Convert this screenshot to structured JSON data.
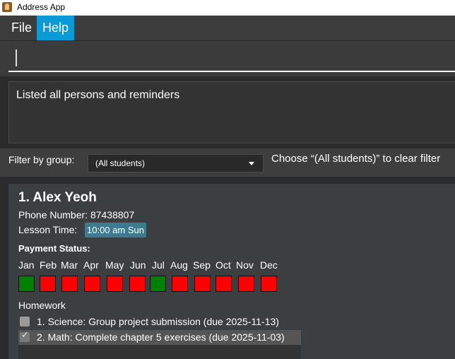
{
  "window": {
    "title": "Address App",
    "icon": "app-icon"
  },
  "menu": {
    "file_label": "File",
    "help_label": "Help"
  },
  "command": {
    "value": "",
    "placeholder": ""
  },
  "result": {
    "message": "Listed all persons and reminders"
  },
  "filter": {
    "label": "Filter by group:",
    "selected": "(All students)",
    "hint": "Choose “(All students)” to clear filter"
  },
  "persons": [
    {
      "index_name": "1. Alex Yeoh",
      "phone": "Phone Number: 87438807",
      "lesson_label": "Lesson Time:",
      "lesson_time": "10:00 am Sun",
      "payment_title": "Payment Status:",
      "months": [
        {
          "label": "Jan",
          "paid": true
        },
        {
          "label": "Feb",
          "paid": false
        },
        {
          "label": "Mar",
          "paid": false
        },
        {
          "label": "Apr",
          "paid": false
        },
        {
          "label": "May",
          "paid": false
        },
        {
          "label": "Jun",
          "paid": false
        },
        {
          "label": "Jul",
          "paid": true
        },
        {
          "label": "Aug",
          "paid": false
        },
        {
          "label": "Sep",
          "paid": false
        },
        {
          "label": "Oct",
          "paid": false
        },
        {
          "label": "Nov",
          "paid": false
        },
        {
          "label": "Dec",
          "paid": false
        }
      ],
      "homework_title": "Homework",
      "homework": [
        {
          "text": "1. Science: Group project submission (due 2025-11-13)",
          "done": false
        },
        {
          "text": "2. Math: Complete chapter 5 exercises (due 2025-11-03)",
          "done": true
        }
      ]
    }
  ],
  "colors": {
    "accent": "#0a9ad8",
    "paid": "#008000",
    "unpaid": "#ff0000",
    "lesson_badge": "#3e7b91"
  }
}
